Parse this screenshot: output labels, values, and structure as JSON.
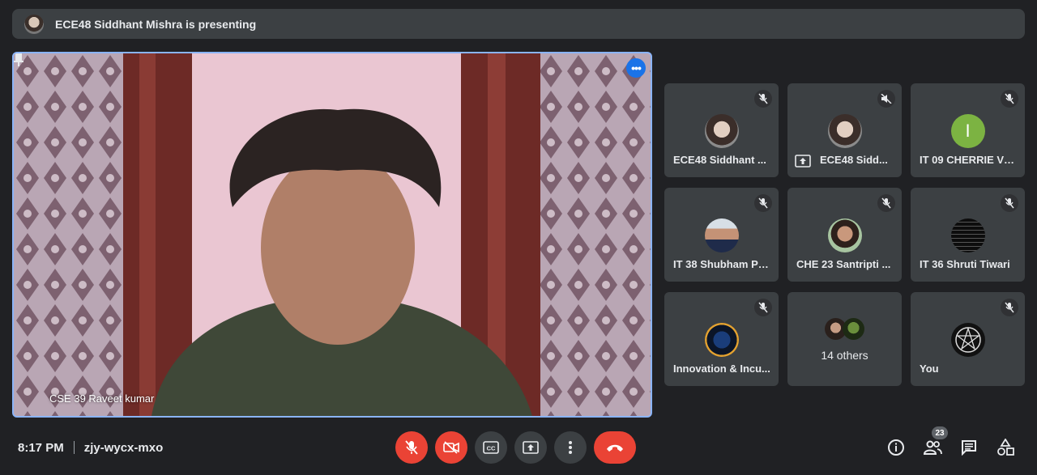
{
  "banner": {
    "text": "ECE48 Siddhant Mishra is presenting"
  },
  "main": {
    "name": "CSE 39 Raveet kumar"
  },
  "tiles": [
    {
      "name": "ECE48 Siddhant ..."
    },
    {
      "name": "ECE48 Sidd..."
    },
    {
      "name": "IT 09 CHERRIE VE...",
      "initial": "I"
    },
    {
      "name": "IT 38 Shubham Pa..."
    },
    {
      "name": "CHE 23 Santripti ..."
    },
    {
      "name": "IT 36 Shruti Tiwari"
    },
    {
      "name": "Innovation & Incu..."
    },
    {
      "name": "14 others"
    },
    {
      "name": "You"
    }
  ],
  "footer": {
    "time": "8:17 PM",
    "meeting_code": "zjy-wycx-mxo",
    "participants_count": "23"
  },
  "icons": {
    "mic_off": "mic-off-icon",
    "camera_off": "camera-off-icon",
    "captions": "captions-icon",
    "present": "present-icon",
    "more": "more-options-icon",
    "hangup": "hangup-icon",
    "info": "info-icon",
    "people": "people-icon",
    "chat": "chat-icon",
    "activities": "activities-icon"
  },
  "colors": {
    "accent": "#8ab4f8",
    "danger": "#ea4335",
    "tile": "#3c4043",
    "background": "#202124"
  }
}
